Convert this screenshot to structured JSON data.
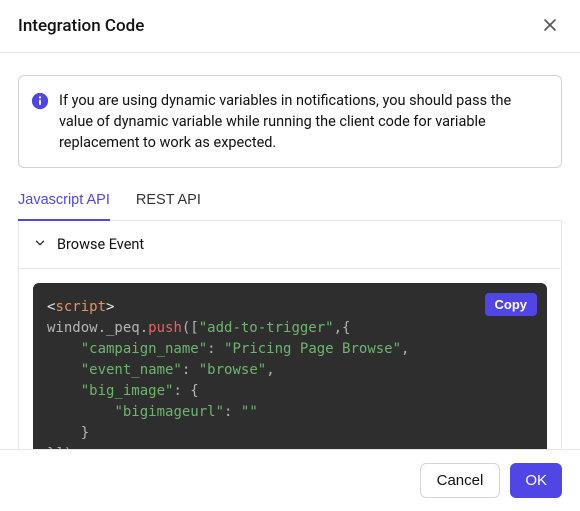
{
  "header": {
    "title": "Integration Code"
  },
  "info": {
    "text": "If you are using dynamic variables in notifications, you should pass the value of dynamic variable while running the client code for variable replacement to work as expected."
  },
  "tabs": [
    {
      "label": "Javascript API",
      "active": true
    },
    {
      "label": "REST API",
      "active": false
    }
  ],
  "section": {
    "title": "Browse Event"
  },
  "code": {
    "copy_label": "Copy",
    "tag_open_lt": "<",
    "tag_name": "script",
    "tag_open_gt": ">",
    "line2a": "window._peq.",
    "line2_push": "push",
    "line2b": "([",
    "line2_str": "\"add-to-trigger\"",
    "line2c": ",{",
    "kv1_key": "\"campaign_name\"",
    "colon": ":",
    "kv1_val": "\"Pricing Page Browse\"",
    "comma": ",",
    "kv2_key": "\"event_name\"",
    "kv2_val": "\"browse\"",
    "kv3_key": "\"big_image\"",
    "kv3_open": " {",
    "kv4_key": "\"bigimageurl\"",
    "kv4_val": "\"\"",
    "close_brace": "    }",
    "close_all": "}]);"
  },
  "footer": {
    "cancel": "Cancel",
    "ok": "OK"
  }
}
